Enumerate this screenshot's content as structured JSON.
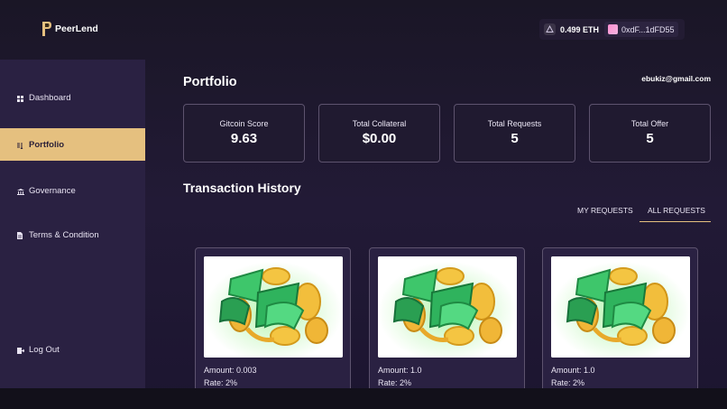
{
  "app": {
    "name": "PeerLend"
  },
  "wallet": {
    "balance": "0.499 ETH",
    "address": "0xdF...1dFD55"
  },
  "sidebar": {
    "items": [
      {
        "label": "Dashboard",
        "icon": "dashboard-icon"
      },
      {
        "label": "Portfolio",
        "icon": "portfolio-icon",
        "active": true
      },
      {
        "label": "Governance",
        "icon": "governance-icon"
      },
      {
        "label": "Terms & Condition",
        "icon": "document-icon"
      },
      {
        "label": "Log Out",
        "icon": "logout-icon"
      }
    ]
  },
  "page": {
    "title": "Portfolio",
    "user_email": "ebukiz@gmail.com"
  },
  "stats": [
    {
      "label": "Gitcoin Score",
      "value": "9.63"
    },
    {
      "label": "Total Collateral",
      "value": "$0.00"
    },
    {
      "label": "Total Requests",
      "value": "5"
    },
    {
      "label": "Total Offer",
      "value": "5"
    }
  ],
  "transactions": {
    "title": "Transaction History",
    "tabs": [
      {
        "label": "MY REQUESTS",
        "active": false
      },
      {
        "label": "ALL REQUESTS",
        "active": true
      }
    ],
    "cards": [
      {
        "amount": "Amount: 0.003",
        "rate": "Rate: 2%"
      },
      {
        "amount": "Amount: 1.0",
        "rate": "Rate: 2%"
      },
      {
        "amount": "Amount: 1.0",
        "rate": "Rate: 2%"
      }
    ]
  },
  "colors": {
    "accent": "#e5c07f",
    "sidebar": "#2a2142",
    "card_border": "#5d536e"
  }
}
